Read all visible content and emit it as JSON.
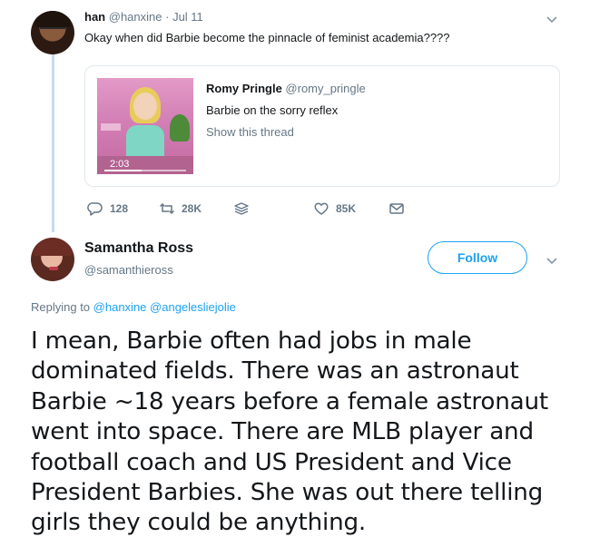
{
  "quoted_reply": {
    "author": {
      "name": "han",
      "handle": "@hanxine",
      "date": "· Jul 11"
    },
    "text": "Okay when did Barbie become the pinnacle of feminist academia????",
    "quote": {
      "author_name": "Romy Pringle",
      "author_handle": "@romy_pringle",
      "text": "Barbie on the sorry reflex",
      "show_thread_label": "Show this thread",
      "video_duration": "2:03",
      "video_progress": 0.45
    },
    "actions": {
      "reply_count": "128",
      "retweet_count": "28K",
      "like_count": "85K"
    }
  },
  "main_tweet": {
    "author": {
      "name": "Samantha Ross",
      "handle": "@samanthieross"
    },
    "follow_label": "Follow",
    "replying_prefix": "Replying to",
    "replying_mentions": [
      "@hanxine",
      "@angelesliejolie"
    ],
    "text_lines": [
      "I mean, Barbie often had jobs in male",
      "dominated fields. There was an astronaut",
      "Barbie ~18 years before a female astronaut",
      "went into space. There are MLB player and",
      "football coach and US President and Vice",
      "President Barbies. She was out there telling",
      "girls they could be anything."
    ]
  },
  "icons": {
    "caret": "chevron-down-icon",
    "reply": "reply-icon",
    "retweet": "retweet-icon",
    "dm": "direct-message-icon",
    "like": "heart-icon",
    "mail": "envelope-icon"
  },
  "colors": {
    "accent": "#1da1f2",
    "secondary_text": "#657786",
    "primary_text": "#14171a",
    "thread_line": "#c4dbf0",
    "border": "#e1e8ed"
  }
}
